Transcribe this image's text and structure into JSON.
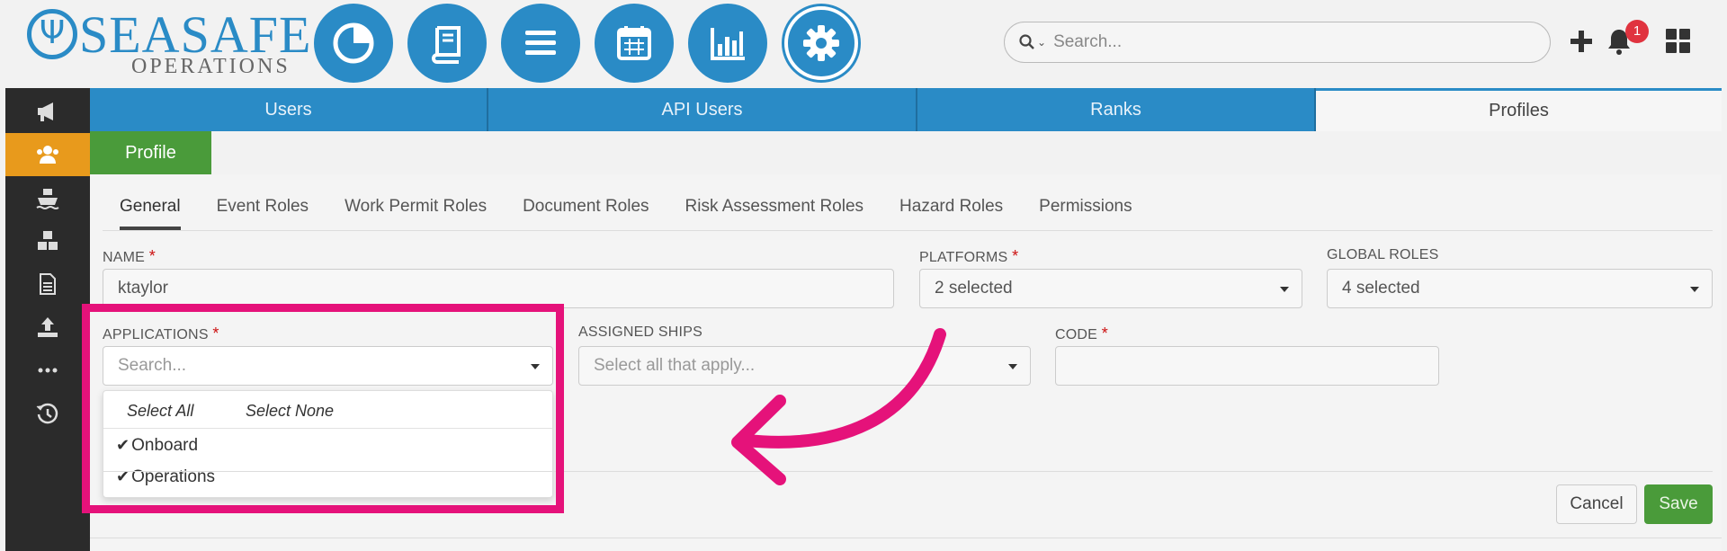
{
  "logo": {
    "brand": "SEASAFE",
    "sub": "OPERATIONS"
  },
  "header": {
    "nav_icons": [
      "pie-chart-icon",
      "book-icon",
      "menu-icon",
      "calendar-icon",
      "bar-chart-icon",
      "gear-icon"
    ],
    "search_placeholder": "Search...",
    "notification_count": "1"
  },
  "rail": {
    "items": [
      "megaphone-icon",
      "users-icon",
      "ship-icon",
      "cubes-icon",
      "document-icon",
      "upload-icon",
      "more-icon",
      "history-icon"
    ],
    "active_index": 1
  },
  "top_tabs": [
    {
      "label": "Users"
    },
    {
      "label": "API Users"
    },
    {
      "label": "Ranks"
    },
    {
      "label": "Profiles"
    }
  ],
  "profile_tab": "Profile",
  "sub_tabs": [
    {
      "label": "General"
    },
    {
      "label": "Event Roles"
    },
    {
      "label": "Work Permit Roles"
    },
    {
      "label": "Document Roles"
    },
    {
      "label": "Risk Assessment Roles"
    },
    {
      "label": "Hazard Roles"
    },
    {
      "label": "Permissions"
    }
  ],
  "form": {
    "name": {
      "label": "NAME",
      "value": "ktaylor"
    },
    "platforms": {
      "label": "PLATFORMS",
      "value": "2 selected"
    },
    "global_roles": {
      "label": "GLOBAL ROLES",
      "value": "4 selected"
    },
    "applications": {
      "label": "APPLICATIONS",
      "placeholder": "Search..."
    },
    "assigned_ships": {
      "label": "ASSIGNED SHIPS",
      "placeholder": "Select all that apply..."
    },
    "code": {
      "label": "CODE",
      "value": ""
    },
    "required_mark": "*"
  },
  "applications_dropdown": {
    "select_all": "Select All",
    "select_none": "Select None",
    "options": [
      {
        "label": "Onboard",
        "checked": true
      },
      {
        "label": "Operations",
        "checked": true
      }
    ],
    "check_glyph": "✔"
  },
  "actions": {
    "cancel": "Cancel",
    "save": "Save"
  },
  "colors": {
    "primary": "#2a8bc6",
    "accent": "#e89a1c",
    "success": "#4a9b3a",
    "highlight": "#e5127a",
    "required": "#cc1111"
  }
}
